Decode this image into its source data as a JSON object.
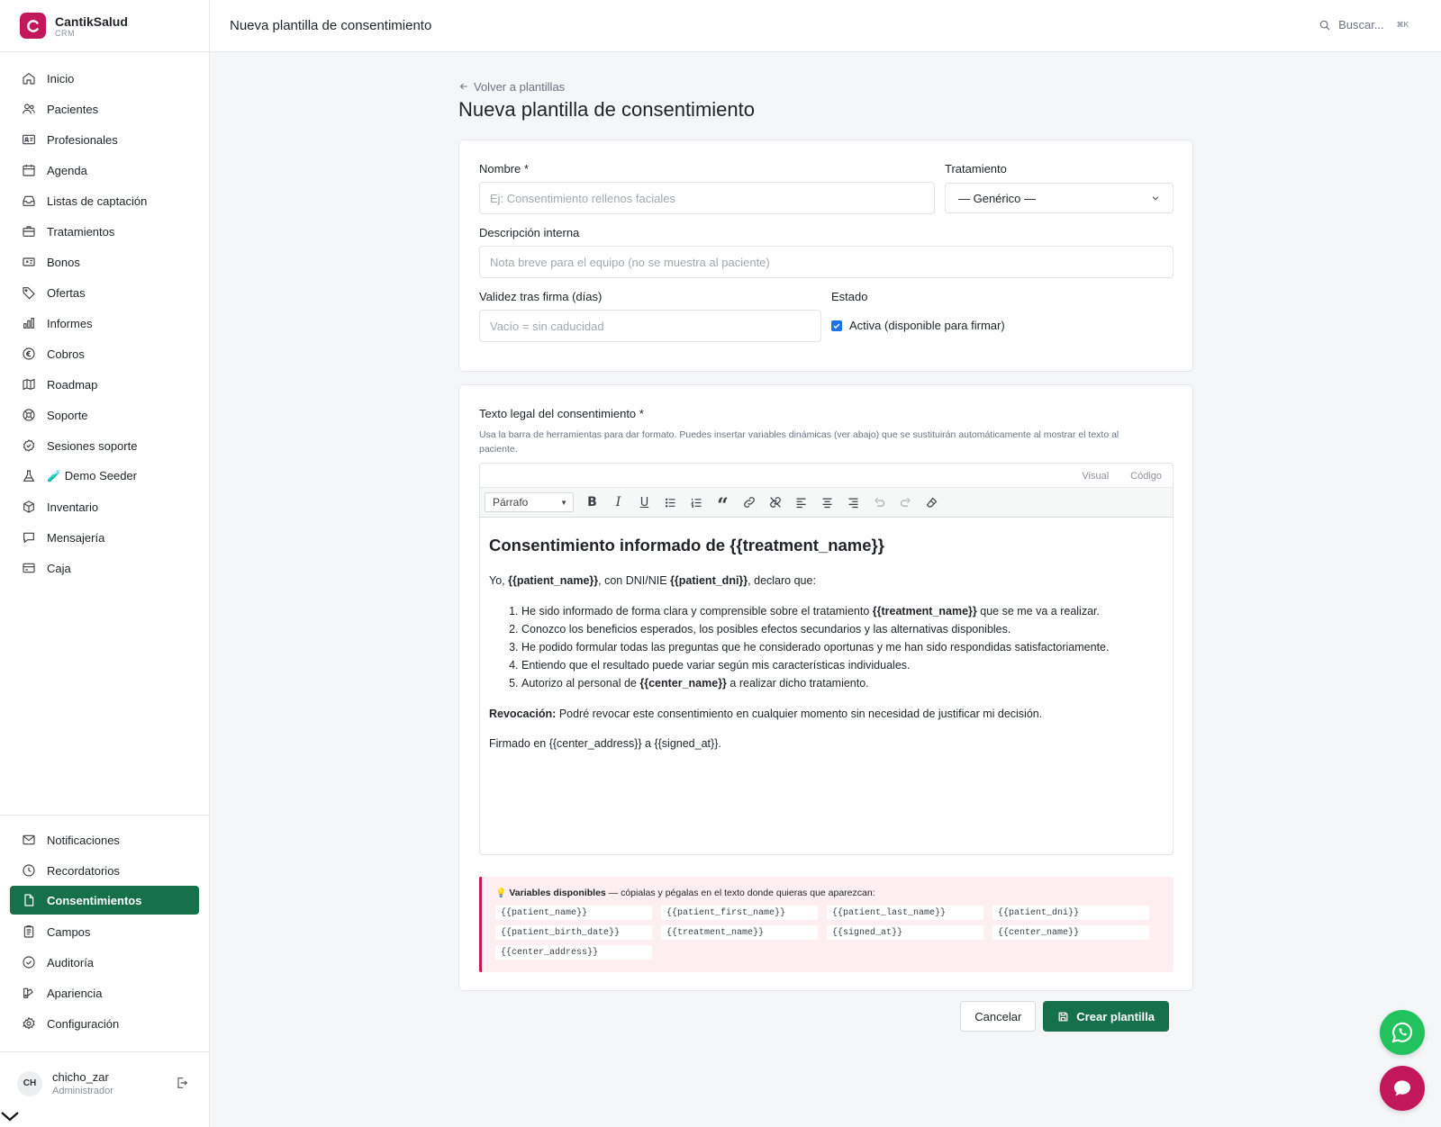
{
  "brand": {
    "name": "CantikSalud",
    "sub": "CRM"
  },
  "nav": {
    "main": [
      {
        "label": "Inicio",
        "icon": "home-icon"
      },
      {
        "label": "Pacientes",
        "icon": "users-icon"
      },
      {
        "label": "Profesionales",
        "icon": "id-card-icon"
      },
      {
        "label": "Agenda",
        "icon": "calendar-icon"
      },
      {
        "label": "Listas de captación",
        "icon": "inbox-icon"
      },
      {
        "label": "Tratamientos",
        "icon": "briefcase-icon"
      },
      {
        "label": "Bonos",
        "icon": "ticket-icon"
      },
      {
        "label": "Ofertas",
        "icon": "tag-icon"
      },
      {
        "label": "Informes",
        "icon": "bar-chart-icon"
      },
      {
        "label": "Cobros",
        "icon": "euro-icon"
      },
      {
        "label": "Roadmap",
        "icon": "map-icon"
      },
      {
        "label": "Soporte",
        "icon": "lifebuoy-icon"
      },
      {
        "label": "Sesiones soporte",
        "icon": "badge-check-icon"
      },
      {
        "label": "🧪 Demo Seeder",
        "icon": "flask-icon"
      },
      {
        "label": "Inventario",
        "icon": "box-icon"
      },
      {
        "label": "Mensajería",
        "icon": "message-icon"
      },
      {
        "label": "Caja",
        "icon": "credit-card-icon"
      }
    ],
    "bottom": [
      {
        "label": "Notificaciones",
        "icon": "mail-icon"
      },
      {
        "label": "Recordatorios",
        "icon": "clock-icon"
      },
      {
        "label": "Consentimientos",
        "icon": "file-icon"
      },
      {
        "label": "Campos",
        "icon": "clipboard-icon"
      },
      {
        "label": "Auditoría",
        "icon": "shield-check-icon"
      },
      {
        "label": "Apariencia",
        "icon": "palette-icon"
      },
      {
        "label": "Configuración",
        "icon": "gear-icon"
      }
    ]
  },
  "user": {
    "initials": "CH",
    "name": "chicho_zar",
    "role": "Administrador"
  },
  "topbar": {
    "title": "Nueva plantilla de consentimiento",
    "search_label": "Buscar...",
    "search_kbd": "⌘K"
  },
  "page": {
    "back_label": "Volver a plantillas",
    "title": "Nueva plantilla de consentimiento"
  },
  "form": {
    "name_label": "Nombre *",
    "name_placeholder": "Ej: Consentimiento rellenos faciales",
    "treatment_label": "Tratamiento",
    "treatment_value": "— Genérico —",
    "desc_label": "Descripción interna",
    "desc_placeholder": "Nota breve para el equipo (no se muestra al paciente)",
    "validity_label": "Validez tras firma (días)",
    "validity_placeholder": "Vacío = sin caducidad",
    "status_label": "Estado",
    "active_label": "Activa (disponible para firmar)"
  },
  "legal": {
    "label": "Texto legal del consentimiento *",
    "help": "Usa la barra de herramientas para dar formato. Puedes insertar variables dinámicas (ver abajo) que se sustituirán automáticamente al mostrar el texto al paciente.",
    "tab_visual": "Visual",
    "tab_code": "Código",
    "format_value": "Párrafo"
  },
  "doc": {
    "heading": "Consentimiento informado de {{treatment_name}}",
    "intro_prefix": "Yo, ",
    "intro_var1": "{{patient_name}}",
    "intro_mid": ", con DNI/NIE ",
    "intro_var2": "{{patient_dni}}",
    "intro_suffix": ", declaro que:",
    "item1_prefix": "He sido informado de forma clara y comprensible sobre el tratamiento ",
    "item1_var": "{{treatment_name}}",
    "item1_suffix": " que se me va a realizar.",
    "item2": "Conozco los beneficios esperados, los posibles efectos secundarios y las alternativas disponibles.",
    "item3": "He podido formular todas las preguntas que he considerado oportunas y me han sido respondidas satisfactoriamente.",
    "item4": "Entiendo que el resultado puede variar según mis características individuales.",
    "item5_prefix": "Autorizo al personal de ",
    "item5_var": "{{center_name}}",
    "item5_suffix": " a realizar dicho tratamiento.",
    "revoke_label": "Revocación:",
    "revoke_text": " Podré revocar este consentimiento en cualquier momento sin necesidad de justificar mi decisión.",
    "signed": "Firmado en {{center_address}} a {{signed_at}}."
  },
  "vars": {
    "title_emoji": "💡",
    "title_bold": "Variables disponibles",
    "title_rest": " — cópialas y pégalas en el texto donde quieras que aparezcan:",
    "items": [
      "{{patient_name}}",
      "{{patient_first_name}}",
      "{{patient_last_name}}",
      "{{patient_dni}}",
      "{{patient_birth_date}}",
      "{{treatment_name}}",
      "{{signed_at}}",
      "{{center_name}}",
      "{{center_address}}"
    ]
  },
  "actions": {
    "cancel": "Cancelar",
    "create": "Crear plantilla"
  },
  "colors": {
    "brand": "#c2185b",
    "primary": "#15704b",
    "whatsapp": "#22c35e"
  }
}
